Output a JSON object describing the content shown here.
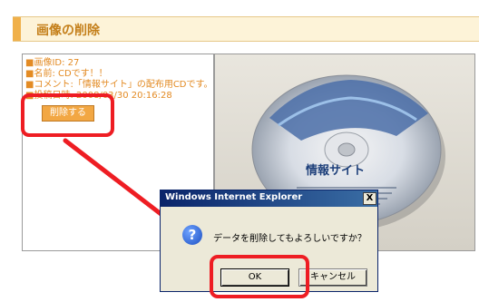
{
  "header": {
    "title": "画像の削除"
  },
  "info": {
    "lines": [
      "■画像ID: 27",
      "■名前: CDです！！",
      "■コメント:「情報サイト」の配布用CDです。",
      "■投稿日時: 2008/03/30 20:16:28"
    ],
    "delete_label": "削除する"
  },
  "photo": {
    "cd_label": "情報サイト"
  },
  "dialog": {
    "title": "Windows Internet Explorer",
    "close_label": "X",
    "message": "データを削除してもよろしいですか？",
    "ok_label": "OK",
    "cancel_label": "キャンセル"
  },
  "colors": {
    "accent": "#f0b04a",
    "highlight": "#ee1d23",
    "dialog_title": "#0a246a"
  }
}
